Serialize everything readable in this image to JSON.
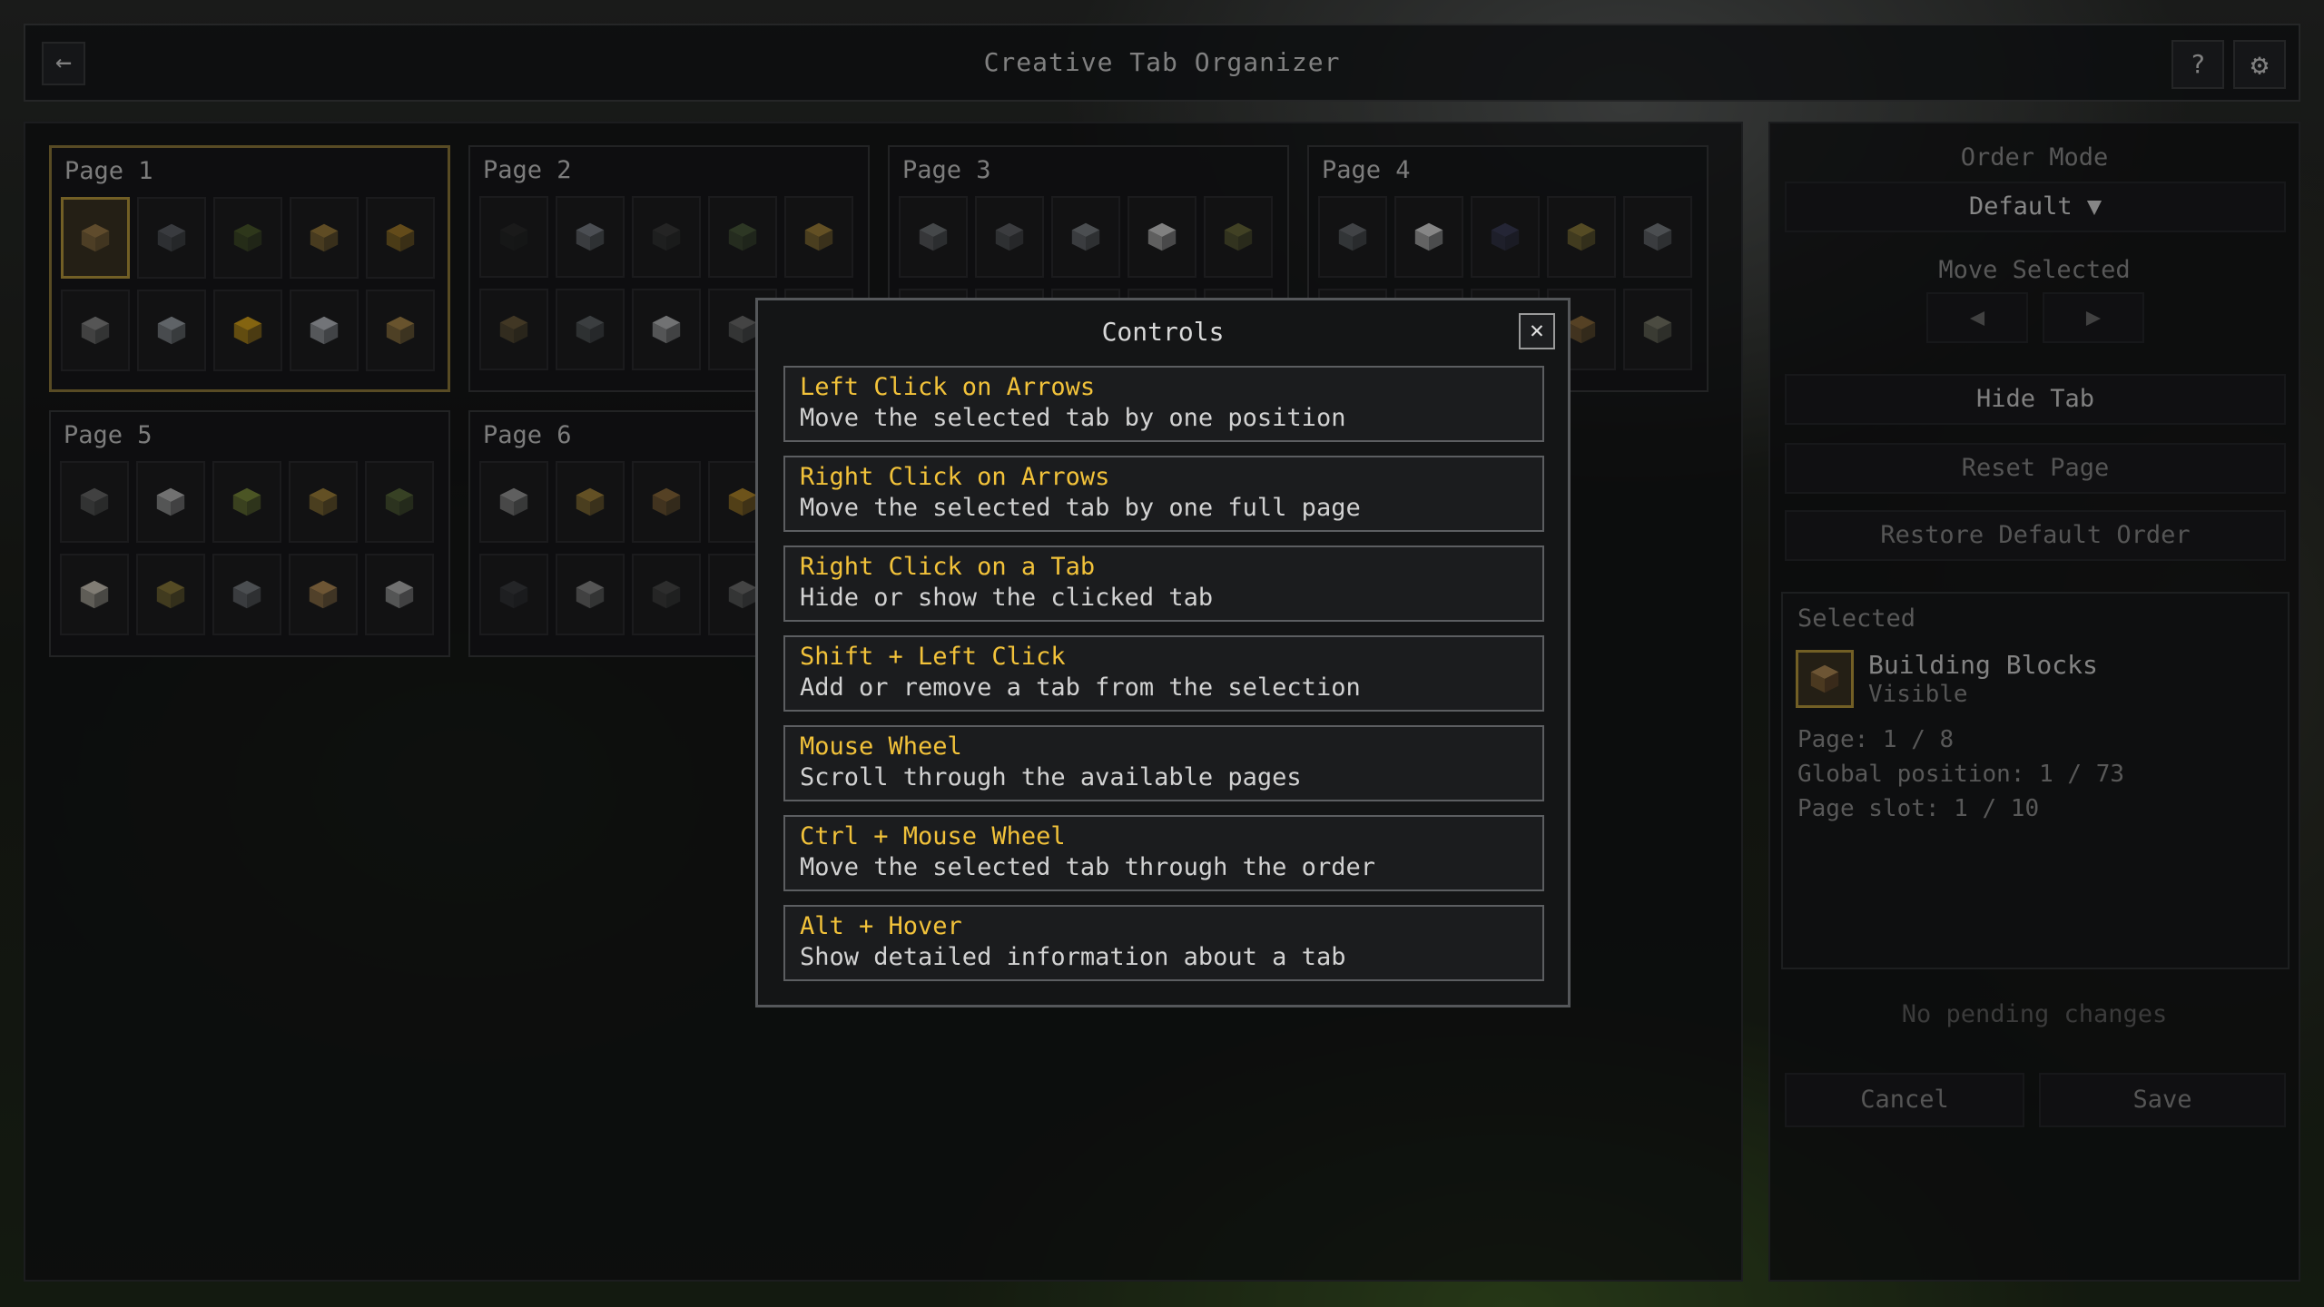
{
  "window": {
    "title": "Creative Tab Organizer",
    "back_glyph": "←",
    "help_glyph": "?",
    "settings_glyph": "⚙"
  },
  "pages": [
    {
      "title": "Page 1",
      "selected": true,
      "icons": [
        "building-blocks-icon",
        "stone-block-icon",
        "grass-block-icon",
        "sign-icon",
        "redstone-dust-icon",
        "pickaxe-icon",
        "sword-icon",
        "apple-icon",
        "iron-ingot-icon",
        "spawn-egg-icon"
      ]
    },
    {
      "title": "Page 2",
      "selected": false,
      "icons": [
        "coal-icon",
        "pillar-icon",
        "seed-icon",
        "sapling-icon",
        "chest-icon",
        "wooden-block-icon",
        "mesh-icon",
        "stone-ball-icon",
        "crate-icon",
        "empty"
      ]
    },
    {
      "title": "Page 3",
      "selected": false,
      "icons": [
        "cobblestone-icon",
        "spear-icon",
        "dark-cube-icon",
        "outline-cube-icon",
        "window-block-icon",
        "empty",
        "empty",
        "empty",
        "empty",
        "empty"
      ]
    },
    {
      "title": "Page 4",
      "selected": false,
      "icons": [
        "dark-stone-icon",
        "white-cube-icon",
        "ore-block-icon",
        "book-icon",
        "dagger-icon",
        "empty",
        "empty",
        "empty",
        "crown-icon",
        "anvil-icon"
      ]
    },
    {
      "title": "Page 5",
      "selected": false,
      "icons": [
        "goggles-icon",
        "wand-icon",
        "moss-chest-icon",
        "wooden-slab-icon",
        "cabinet-icon",
        "bucket-icon",
        "disk-icon",
        "staircase-icon",
        "scroll-icon",
        "shield-emblem-icon"
      ]
    },
    {
      "title": "Page 6",
      "selected": false,
      "icons": [
        "lattice-icon",
        "lantern-icon",
        "barrel-icon",
        "gear-icon",
        "empty",
        "dark-pillar-icon",
        "pressure-plate-icon",
        "small-gear-icon",
        "crate-icon",
        "empty"
      ]
    }
  ],
  "controls_modal": {
    "title": "Controls",
    "close_glyph": "✕",
    "items": [
      {
        "key": "Left Click on Arrows",
        "desc": "Move the selected tab by one position"
      },
      {
        "key": "Right Click on Arrows",
        "desc": "Move the selected tab by one full page"
      },
      {
        "key": "Right Click on a Tab",
        "desc": "Hide or show the clicked tab"
      },
      {
        "key": "Shift + Left Click",
        "desc": "Add or remove a tab from the selection"
      },
      {
        "key": "Mouse Wheel",
        "desc": "Scroll through the available pages"
      },
      {
        "key": "Ctrl + Mouse Wheel",
        "desc": "Move the selected tab through the order"
      },
      {
        "key": "Alt + Hover",
        "desc": "Show detailed information about a tab"
      }
    ]
  },
  "sidebar": {
    "order_mode_label": "Order Mode",
    "order_mode_value": "Default ▼",
    "move_selected_label": "Move Selected",
    "move_left_glyph": "◀",
    "move_right_glyph": "▶",
    "hide_tab": "Hide Tab",
    "reset_page": "Reset Page",
    "restore_default": "Restore Default Order",
    "selected": {
      "label": "Selected",
      "name": "Building Blocks",
      "visibility": "Visible",
      "page": "Page: 1 / 8",
      "global_position": "Global position: 1 / 73",
      "page_slot": "Page slot: 1 / 10"
    },
    "pending": "No pending changes",
    "cancel": "Cancel",
    "save": "Save"
  },
  "colors": {
    "accent_gold": "#f2c23a",
    "selection_border": "#b89a3c"
  }
}
